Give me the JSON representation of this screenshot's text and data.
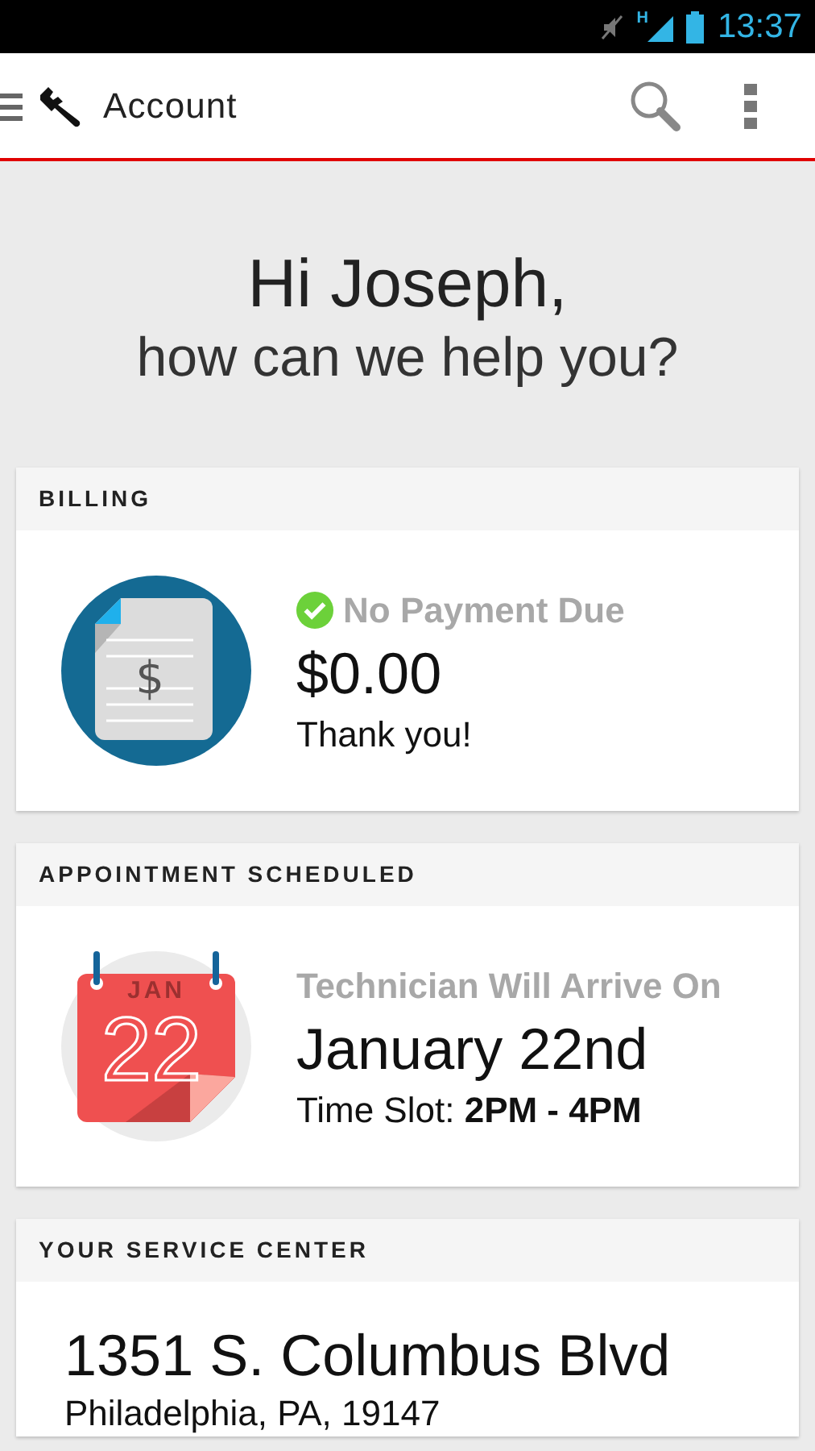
{
  "status_bar": {
    "network": "H",
    "time": "13:37"
  },
  "action_bar": {
    "title": "Account"
  },
  "greeting": {
    "line_1": "Hi Joseph,",
    "line_2": "how can we help you?"
  },
  "billing": {
    "header": "BILLING",
    "icon_symbol": "$",
    "status": "No Payment Due",
    "paid": true,
    "amount": "$0.00",
    "note": "Thank you!"
  },
  "appointment": {
    "header": "APPOINTMENT SCHEDULED",
    "calendar_month": "JAN",
    "calendar_day": "22",
    "label": "Technician Will Arrive On",
    "date": "January 22nd",
    "time_slot": "Time Slot: **2PM - 4PM**"
  },
  "service_center": {
    "header": "YOUR SERVICE CENTER",
    "address_line_1": "1351 S. Columbus Blvd",
    "address_line_2": "Philadelphia, PA, 19147"
  }
}
